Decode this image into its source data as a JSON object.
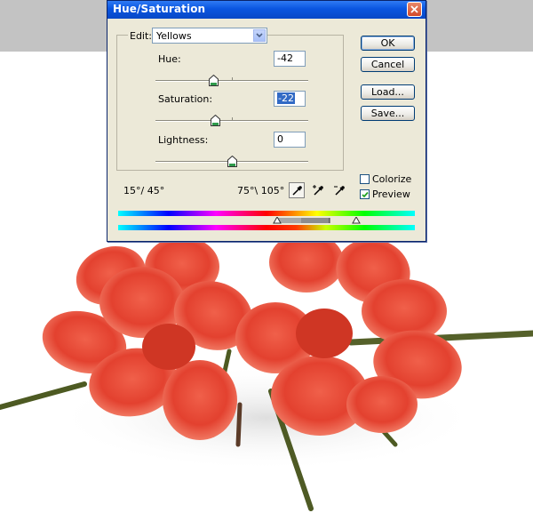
{
  "dialog": {
    "title": "Hue/Saturation",
    "edit_label": "Edit:",
    "edit_value": "Yellows",
    "hue": {
      "label": "Hue:",
      "value": "-42",
      "level": -42,
      "min": -180,
      "max": 180
    },
    "saturation": {
      "label": "Saturation:",
      "value": "-22",
      "level": -22,
      "min": -100,
      "max": 100
    },
    "lightness": {
      "label": "Lightness:",
      "value": "0",
      "level": 0,
      "min": -100,
      "max": 100
    },
    "buttons": {
      "ok": "OK",
      "cancel": "Cancel",
      "load": "Load...",
      "save": "Save..."
    },
    "colorize": {
      "label": "Colorize",
      "checked": false
    },
    "preview": {
      "label": "Preview",
      "checked": true
    },
    "range_left": "15°/ 45°",
    "range_right": "75°\\ 105°"
  },
  "icons": {
    "close": "close-icon",
    "dropdown": "chevron-down-icon",
    "eyedropper": "eyedropper-icon",
    "eyedropper_plus": "eyedropper-plus-icon",
    "eyedropper_minus": "eyedropper-minus-icon",
    "slider_thumb": "slider-thumb-icon"
  },
  "colors": {
    "titlebar": "#0a55e0",
    "dialog_bg": "#ece9d8",
    "flower": "#e8453a",
    "stem": "#4a5a22",
    "background_band": "#c3c3c3"
  }
}
